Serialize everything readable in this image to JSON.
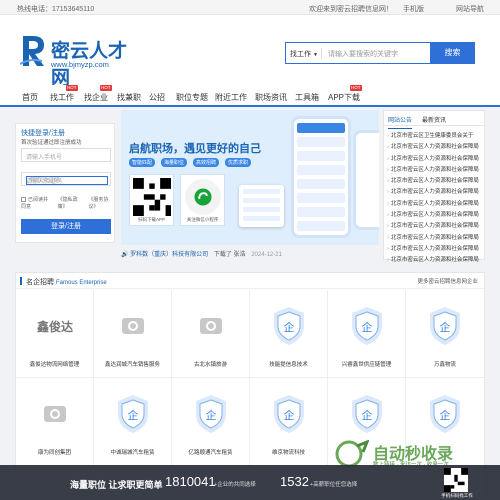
{
  "topbar": {
    "phone": "热线电话：17153645110",
    "welcome": "欢迎来到密云招聘信息网！",
    "mobile": "手机版",
    "site_nav": "网站导航"
  },
  "logo": {
    "name": "密云人才网",
    "url": "www.bjmyzp.com"
  },
  "search": {
    "type": "找工作",
    "placeholder": "请输入要搜索的关键字",
    "button": "搜索"
  },
  "nav": {
    "items": [
      "首页",
      "找工作",
      "找企业",
      "找兼职",
      "公招",
      "职位专题",
      "附近工作",
      "职场资讯",
      "工具箱",
      "APP下载"
    ],
    "hot": "HOT"
  },
  "login": {
    "title": "快捷登录/注册",
    "sub": "首次验证通过即注册成功",
    "phone_ph": "请输入手机号",
    "code_ph": "请输入验证码",
    "code_btn": "获取验证码",
    "agree": "已阅读并同意",
    "privacy": "《隐私政策》",
    "service": "《服务协议》",
    "submit": "登录/注册"
  },
  "banner": {
    "title": "启航职场，遇见更好的自己",
    "tags": [
      "智能匹配",
      "海量职位",
      "高效招聘",
      "优质求职"
    ],
    "qr1_caption": "扫码下载APP",
    "qr2_caption": "关注微信小程序"
  },
  "company_line": {
    "company": "罗科数（重庆）科技有限公司",
    "action": "下载了",
    "person": "张浩",
    "date": "2024-12-21"
  },
  "announcements": {
    "tabs": [
      "网站公告",
      "最新资讯"
    ],
    "items": [
      "北京市密云区卫生健康委员会关于",
      "北京市密云区人力资源和社会保障局",
      "北京市密云区人力资源和社会保障局",
      "北京市密云区人力资源和社会保障局",
      "北京市密云区人力资源和社会保障局",
      "北京市密云区人力资源和社会保障局",
      "北京市密云区人力资源和社会保障局",
      "北京市密云区人力资源和社会保障局",
      "北京市密云区人力资源和社会保障局",
      "北京市密云区人力资源和社会保障局",
      "北京市密云区人力资源和社会保障局",
      "北京市密云区人力资源和社会保障局"
    ]
  },
  "enterprises": {
    "title": "名企招聘",
    "title_en": "Famous Enterprise",
    "more": "更多密云招聘信息网企业",
    "row1": [
      {
        "name": "鑫俊达物流网络管理",
        "logo": "鑫俊达"
      },
      {
        "name": "鑫达润城汽车销售服务",
        "logo": ""
      },
      {
        "name": "古北水镇旅游",
        "logo": ""
      },
      {
        "name": "技能提信息技术",
        "logo": ""
      },
      {
        "name": "兴睿鑫世供应链管理",
        "logo": ""
      },
      {
        "name": "万鑫物流",
        "logo": ""
      }
    ],
    "row2": [
      {
        "name": "康为同创集团",
        "logo": ""
      },
      {
        "name": "中诚瑞城汽车租赁",
        "logo": ""
      },
      {
        "name": "亿路顺通汽车租赁",
        "logo": ""
      },
      {
        "name": "维京物流科技",
        "logo": ""
      },
      {
        "name": "",
        "logo": ""
      },
      {
        "name": "",
        "logo": ""
      }
    ]
  },
  "bottombar": {
    "text": "海量职位 让求职更简单",
    "n1": "1810041",
    "s1": "+企业的共同选择",
    "n2": "1532",
    "s2": "+高薪职位任您选择",
    "app": "手机扫码找工作"
  },
  "watermark": {
    "big": "自动秒收录",
    "small": "数上链接 · 来访一次 · 收录一次"
  }
}
